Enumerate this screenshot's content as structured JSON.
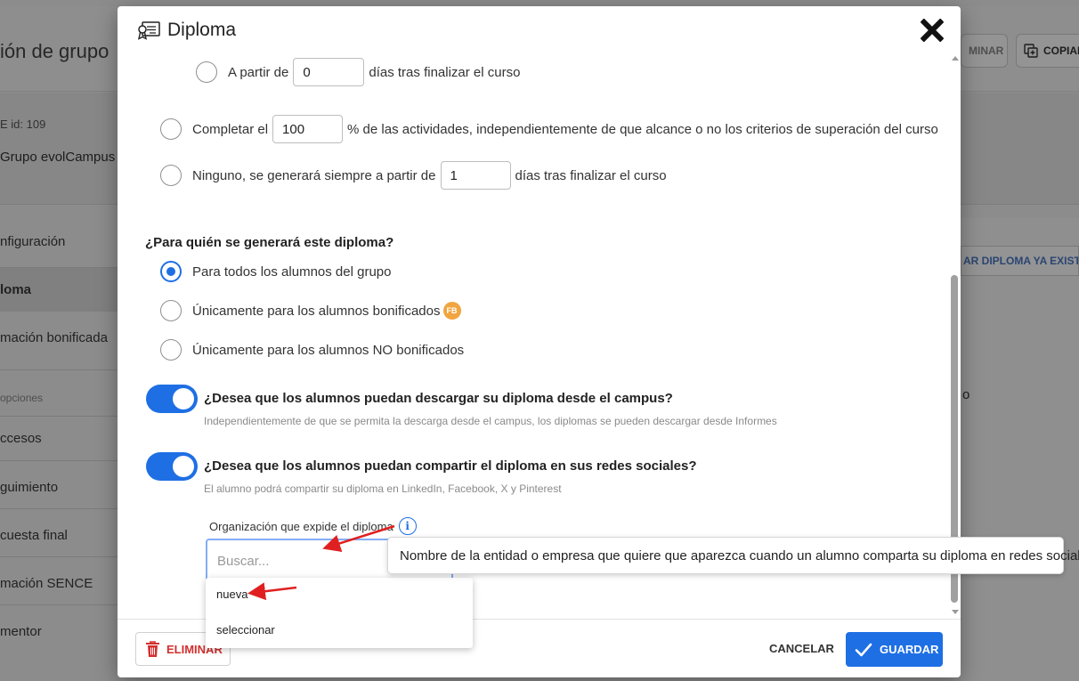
{
  "background": {
    "title": "ión de grupo",
    "buttons": {
      "delete_label": "MINAR",
      "copy_label": "COPIAR"
    },
    "info": {
      "id_line": "E   id: 109",
      "group_name": "Grupo evolCampus"
    },
    "sidebar": {
      "items": [
        "nfiguración",
        "loma",
        "mación bonificada"
      ],
      "options_heading": "opciones",
      "options_items": [
        "ccesos",
        "guimiento",
        "cuesta final",
        "mación SENCE",
        "mentor"
      ]
    },
    "right_link": "AR DIPLOMA YA EXISTE",
    "right_text": "o"
  },
  "modal": {
    "title": "Diploma",
    "criteria": {
      "days_after": {
        "prefix": "A partir de",
        "value": "0",
        "suffix": "días tras finalizar el curso"
      },
      "complete": {
        "prefix": "Completar el",
        "value": "100",
        "suffix": "% de las actividades, independientemente de que alcance o no los criterios de superación del curso"
      },
      "none": {
        "prefix": "Ninguno, se generará siempre a partir de",
        "value": "1",
        "suffix": "días tras finalizar el curso"
      }
    },
    "audience": {
      "question": "¿Para quién se generará este diploma?",
      "options": [
        {
          "label": "Para todos los alumnos del grupo",
          "checked": true
        },
        {
          "label": "Únicamente para los alumnos bonificados",
          "checked": false,
          "badge": "FB"
        },
        {
          "label": "Únicamente para los alumnos NO bonificados",
          "checked": false
        }
      ]
    },
    "download_toggle": {
      "label": "¿Desea que los alumnos puedan descargar su diploma desde el campus?",
      "help": "Independientemente de que se permita la descarga desde el campus, los diplomas se pueden descargar desde Informes",
      "on": true
    },
    "share_toggle": {
      "label": "¿Desea que los alumnos puedan compartir el diploma en sus redes sociales?",
      "help": "El alumno podrá compartir su diploma en LinkedIn, Facebook, X y Pinterest",
      "on": true
    },
    "organization": {
      "label": "Organización que expide el diploma",
      "info_glyph": "i",
      "search_placeholder": "Buscar...",
      "dropdown_options": [
        "nueva",
        "seleccionar"
      ],
      "tooltip": "Nombre de la entidad o empresa que quiere que aparezca cuando un alumno comparta su diploma en redes sociales"
    },
    "footer": {
      "delete_label": "ELIMINAR",
      "cancel_label": "CANCELAR",
      "save_label": "GUARDAR"
    }
  },
  "colors": {
    "primary": "#1e6fe4",
    "danger": "#d32f2f",
    "badge": "#f0a541",
    "annotation_arrow": "#e02020"
  }
}
